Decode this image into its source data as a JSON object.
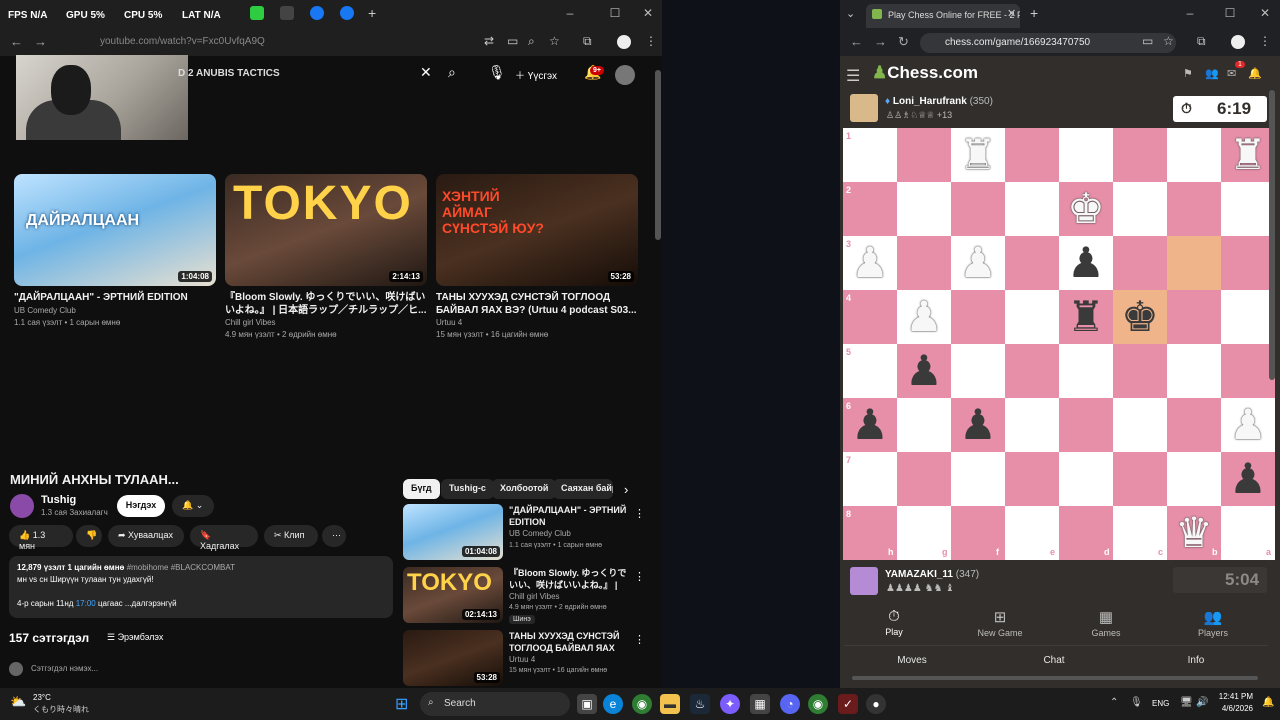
{
  "overlay": {
    "fps_label": "FPS",
    "fps_val": "N/A",
    "gpu_label": "GPU",
    "gpu_val": "5%",
    "cpu_label": "CPU",
    "cpu_val": "5%",
    "lat_label": "LAT",
    "lat_val": "N/A"
  },
  "youtube": {
    "url": "youtube.com/watch?v=Fxc0UvfqA9Q",
    "search_value": "D 2 ANUBIS TACTICS",
    "create_label": "Үүсгэх",
    "notif_badge": "9+",
    "videos": [
      {
        "title": "\"ДАЙРАЛЦААН\" - ЭРТНИЙ EDITION",
        "channel": "UB Comedy Club",
        "meta": "1.1 сая үзэлт • 1 сарын өмнө",
        "duration": "1:04:08",
        "thumb_text": "ДАЙРАЛЦААН"
      },
      {
        "title": "『Bloom Slowly. ゆっくりでいい、咲けばいいよね。』 | 日本語ラップ／チルラップ／ヒ...",
        "channel": "Chill girl Vibes",
        "meta": "4.9 мян үзэлт • 2 өдрийн өмнө",
        "duration": "2:14:13",
        "thumb_text": "TOKYO"
      },
      {
        "title": "ТАНЫ ХУУХЭД СУНСТЭЙ ТОГЛООД БАЙВАЛ ЯАХ ВЭ? (Urtuu 4 podcast S03...",
        "channel": "Urtuu 4",
        "meta": "15 мян үзэлт • 16 цагийн өмнө",
        "duration": "53:28",
        "thumb_text": "ХЭНТИЙ АЙМАГ СҮНСТЭЙ ЮУ?"
      }
    ],
    "current": {
      "title": "МИНИЙ АНХНЫ ТУЛААН...",
      "channel": "Tushig",
      "subs": "1.3 сая Захиалагч",
      "join_label": "Нэгдэх",
      "like_count": "1.3 мян",
      "share_label": "Хуваалцах",
      "save_label": "Хадгалах",
      "clip_label": "Клип",
      "desc_stats": "12,879 үзэлт  1 цагийн өмнө",
      "desc_tags": "#mobihome #BLACKCOMBAT",
      "desc_line2": "мн vs cн Ширүүн тулаан тун удахгүй!",
      "desc_line3_pre": "4-р сарын 11нд",
      "desc_line3_time": "17:00",
      "desc_line3_post": "цагаас ...далгэрэнгүй",
      "comment_count": "157 сэтгэгдэл",
      "sort_label": "Эрэмбэлэх",
      "comment_placeholder": "Сэтгэгдэл нэмэх..."
    },
    "chips": [
      "Бүгд",
      "Tushig-с",
      "Холбоотой",
      "Саяхан байр"
    ],
    "sidebar": [
      {
        "title": "\"ДАЙРАЛЦААН\" - ЭРТНИЙ EDITION",
        "channel": "UB Comedy Club",
        "meta": "1.1 сая үзэлт • 1 сарын өмнө",
        "duration": "01:04:08"
      },
      {
        "title": "『Bloom Slowly. ゆっくりでいい、咲けばいいよね。』 | 日本...",
        "channel": "Chill girl Vibes",
        "meta": "4.9 мян үзэлт • 2 өдрийн өмнө",
        "duration": "02:14:13",
        "badge": "Шинэ"
      },
      {
        "title": "ТАНЫ ХУУХЭД СУНСТЭЙ ТОГЛООД БАЙВАЛ ЯАХ ВЭ? ...",
        "channel": "Urtuu 4",
        "meta": "15 мян үзэлт • 16 цагийн өмнө",
        "duration": "53:28"
      }
    ]
  },
  "chess": {
    "tab_title": "Play Chess Online for FREE - 2 P",
    "url": "chess.com/game/166923470750",
    "logo": "Chess.com",
    "top_player": {
      "name": "Loni_Harufrank",
      "rating": "(350)",
      "captured": "+13",
      "clock": "6:19"
    },
    "bottom_player": {
      "name": "YAMAZAKI_11",
      "rating": "(347)",
      "clock": "5:04"
    },
    "ranks": [
      "1",
      "2",
      "3",
      "4",
      "5",
      "6",
      "7",
      "8"
    ],
    "files": [
      "h",
      "g",
      "f",
      "e",
      "d",
      "c",
      "b",
      "a"
    ],
    "pieces": [
      {
        "sq": "f1",
        "p": "♜",
        "c": "w"
      },
      {
        "sq": "a1",
        "p": "♜",
        "c": "w"
      },
      {
        "sq": "d2",
        "p": "♚",
        "c": "w"
      },
      {
        "sq": "h3",
        "p": "♟",
        "c": "w"
      },
      {
        "sq": "f3",
        "p": "♟",
        "c": "w"
      },
      {
        "sq": "d3",
        "p": "♟",
        "c": "b"
      },
      {
        "sq": "g4",
        "p": "♟",
        "c": "w"
      },
      {
        "sq": "d4",
        "p": "♜",
        "c": "b"
      },
      {
        "sq": "c4",
        "p": "♚",
        "c": "b"
      },
      {
        "sq": "g5",
        "p": "♟",
        "c": "b"
      },
      {
        "sq": "h6",
        "p": "♟",
        "c": "b"
      },
      {
        "sq": "f6",
        "p": "♟",
        "c": "b"
      },
      {
        "sq": "a6",
        "p": "♟",
        "c": "w"
      },
      {
        "sq": "a7",
        "p": "♟",
        "c": "b"
      },
      {
        "sq": "b8",
        "p": "♛",
        "c": "w"
      }
    ],
    "highlight": [
      "b3",
      "c4"
    ],
    "nav": [
      {
        "icon": "⏱",
        "label": "Play"
      },
      {
        "icon": "⊞",
        "label": "New Game"
      },
      {
        "icon": "▦",
        "label": "Games"
      },
      {
        "icon": "👥",
        "label": "Players"
      }
    ],
    "subtabs": [
      "Moves",
      "Chat",
      "Info"
    ],
    "top_badge": "1"
  },
  "taskbar": {
    "weather_temp": "23°C",
    "weather_desc": "くもり時々晴れ",
    "search_label": "Search",
    "lang": "ENG",
    "time": "12:41 PM",
    "date": "4/6/2026"
  }
}
